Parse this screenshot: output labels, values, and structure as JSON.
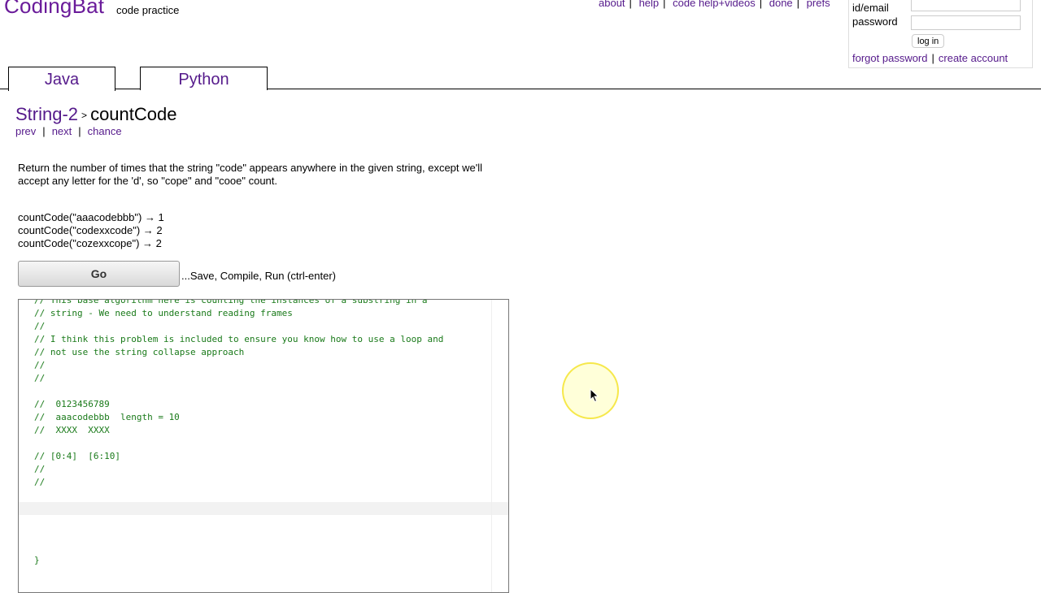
{
  "header": {
    "brand": "CodingBat",
    "tagline": "code practice",
    "nav": [
      "about",
      "help",
      "code help+videos",
      "done",
      "prefs"
    ]
  },
  "login": {
    "id_label": "id/email",
    "password_label": "password",
    "button": "log in",
    "forgot": "forgot password",
    "create": "create account"
  },
  "tabs": [
    "Java",
    "Python"
  ],
  "breadcrumb": {
    "section": "String-2",
    "separator": ">",
    "problem": "countCode"
  },
  "subnav": [
    "prev",
    "next",
    "chance"
  ],
  "description": "Return the number of times that the string \"code\" appears anywhere in the given string, except we'll accept any letter for the 'd', so \"cope\" and \"cooe\" count.",
  "examples": [
    "countCode(\"aaacodebbb\") → 1",
    "countCode(\"codexxcode\") → 2",
    "countCode(\"cozexxcope\") → 2"
  ],
  "run": {
    "button": "Go",
    "hint": "...Save, Compile, Run (ctrl-enter)"
  },
  "editor": {
    "code": "// This base algorithm here is counting the instances of a substring in a\n// string - We need to understand reading frames\n//\n// I think this problem is included to ensure you know how to use a loop and\n// not use the string collapse approach\n//\n//\n\n//  0123456789\n//  aaacodebbb  length = 10\n//  XXXX  XXXX\n\n// [0:4]  [6:10]\n//\n//\n\n\n\n\n\n}"
  },
  "colors": {
    "brand": "#6a1b9a",
    "link": "#551a8b",
    "code_comment": "#1a7a1a",
    "cursor_highlight": "#f5e63c"
  }
}
